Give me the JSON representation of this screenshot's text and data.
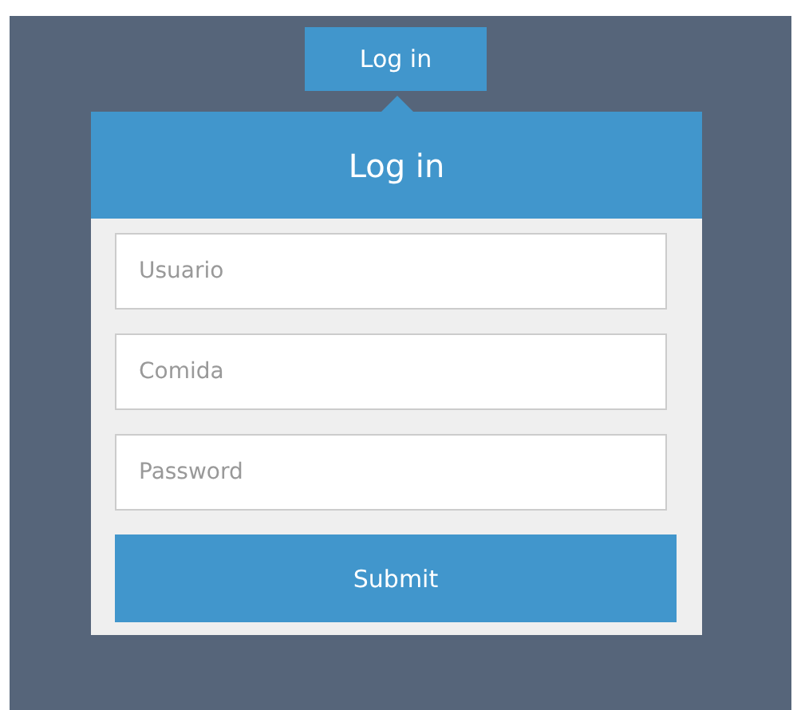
{
  "toggle_button": {
    "label": "Log in"
  },
  "form": {
    "title": "Log in",
    "fields": [
      {
        "placeholder": "Usuario"
      },
      {
        "placeholder": "Comida"
      },
      {
        "placeholder": "Password"
      }
    ],
    "submit": {
      "label": "Submit"
    }
  }
}
